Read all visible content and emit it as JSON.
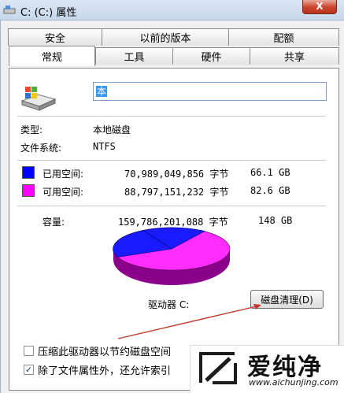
{
  "window": {
    "title": "C: (C:) 属性",
    "close_label": "X"
  },
  "tabs_row1": [
    "安全",
    "以前的版本",
    "配额"
  ],
  "tabs_row2": [
    "常规",
    "工具",
    "硬件",
    "共享"
  ],
  "active_tab": "常规",
  "general": {
    "volume_name": "本",
    "type_label": "类型:",
    "type_value": "本地磁盘",
    "fs_label": "文件系统:",
    "fs_value": "NTFS",
    "used": {
      "label": "已用空间:",
      "bytes": "70,989,049,856 字节",
      "size": "66.1 GB",
      "color": "#0000ff"
    },
    "free": {
      "label": "可用空间:",
      "bytes": "88,797,151,232 字节",
      "size": "82.6 GB",
      "color": "#ff00ff"
    },
    "capacity": {
      "label": "容量:",
      "bytes": "159,786,201,088 字节",
      "size": "148 GB"
    },
    "drive_label": "驱动器 C:",
    "cleanup_button": "磁盘清理(D)",
    "compress_option": {
      "label": "压缩此驱动器以节约磁盘空间",
      "checked": false
    },
    "index_option": {
      "label": "除了文件属性外，还允许索引",
      "checked": true
    }
  },
  "watermark": {
    "brand": "爱纯净",
    "url": "www.aichunjing.com"
  }
}
